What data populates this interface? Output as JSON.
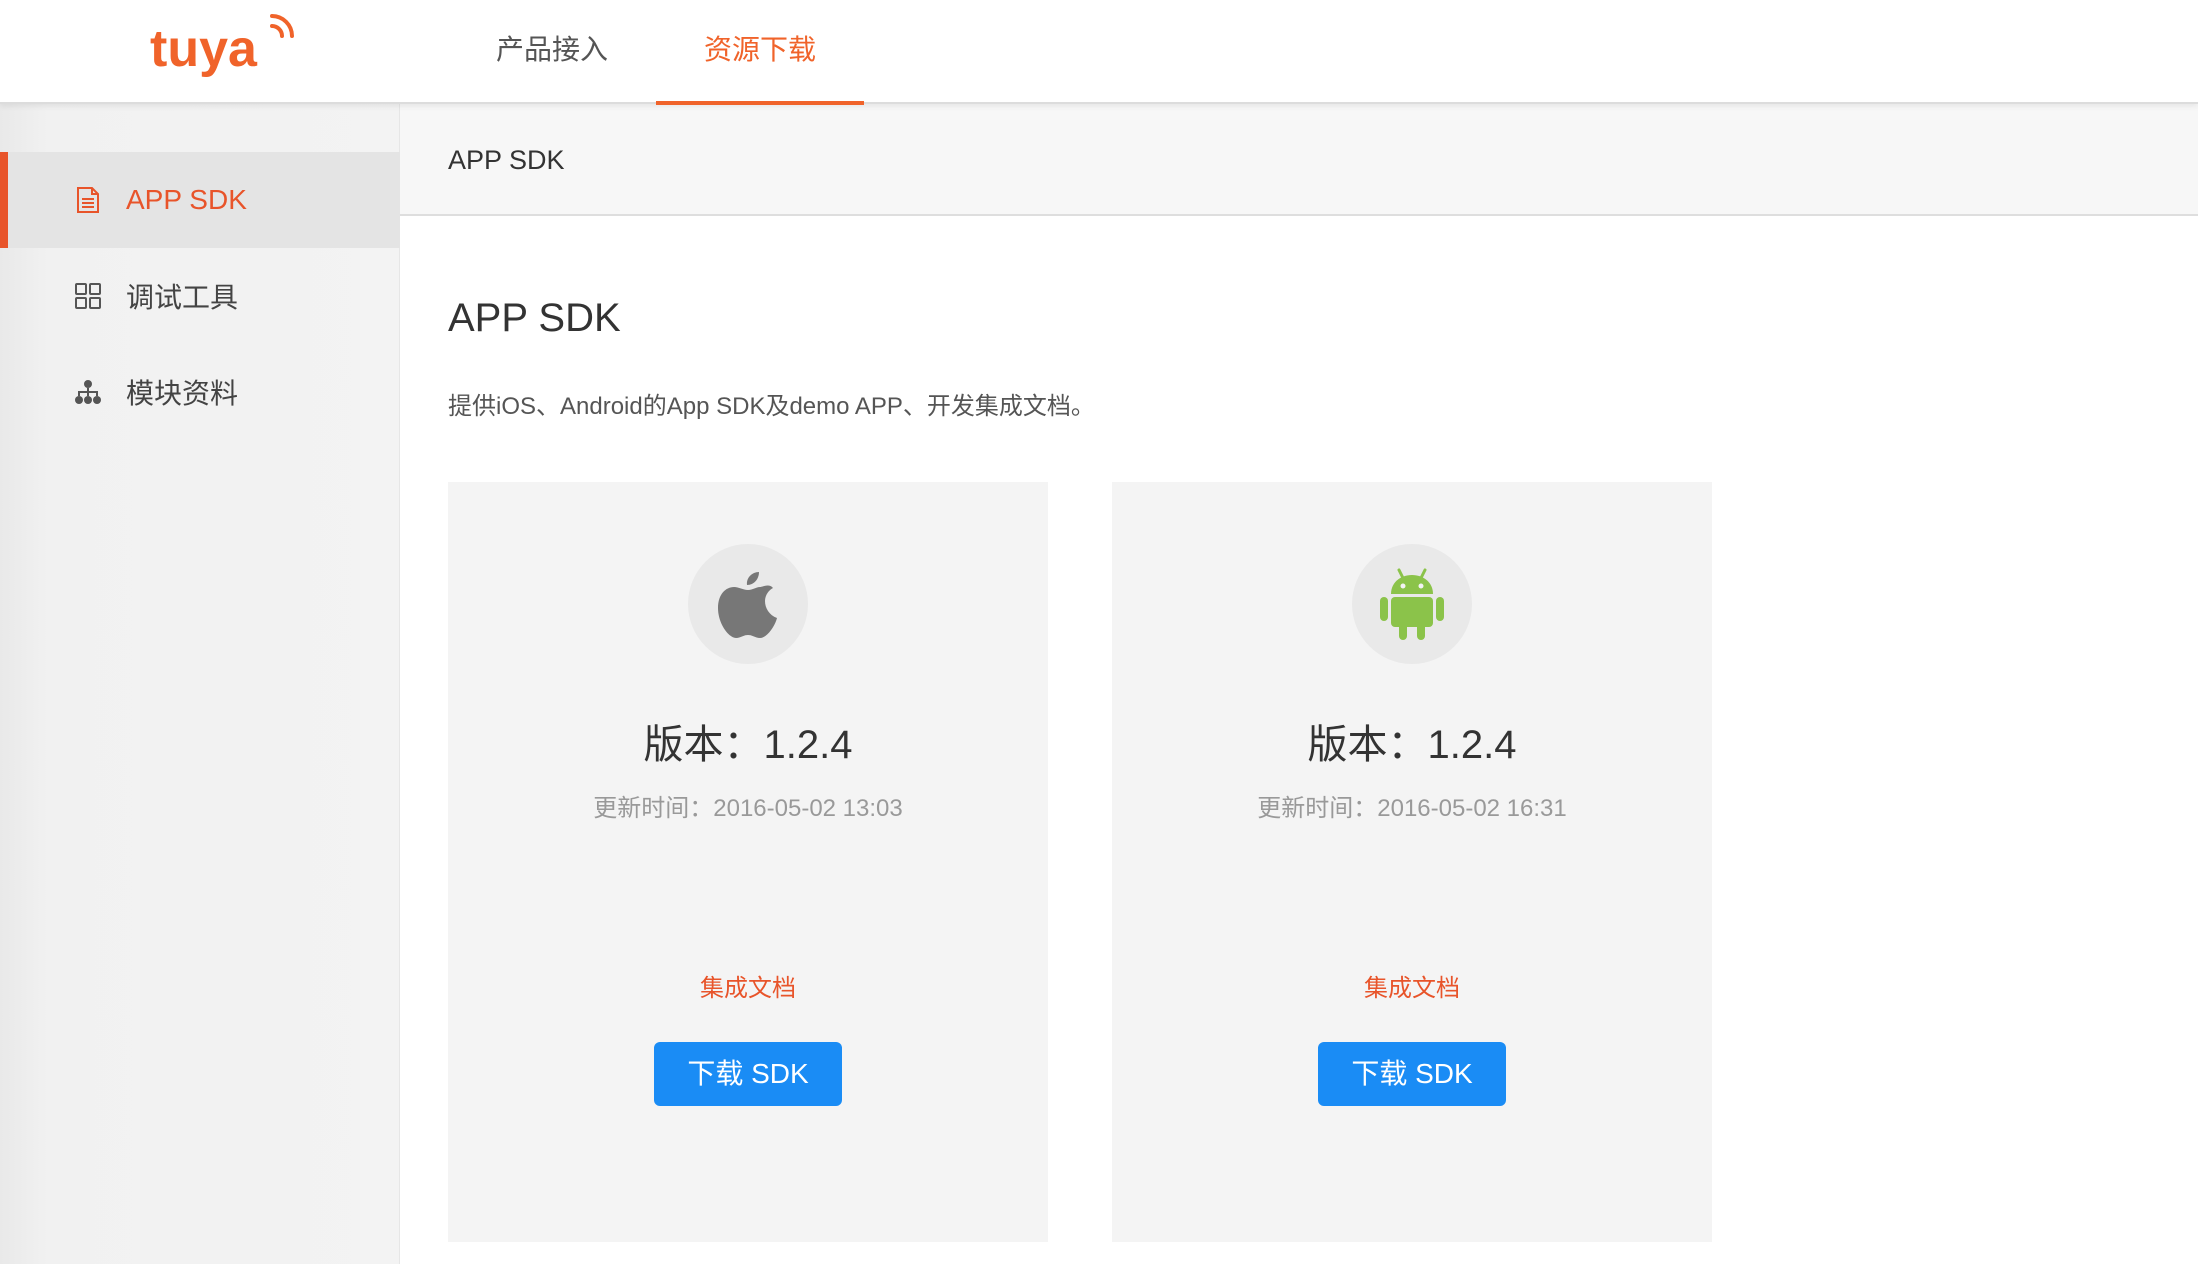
{
  "brand": {
    "logo_text": "tuya",
    "color": "#f0632a"
  },
  "nav": {
    "tabs": [
      {
        "label": "产品接入",
        "active": false
      },
      {
        "label": "资源下载",
        "active": true
      }
    ],
    "active_color": "#f0632a"
  },
  "sidebar": {
    "items": [
      {
        "label": "APP SDK",
        "icon": "document-icon",
        "active": true
      },
      {
        "label": "调试工具",
        "icon": "grid-icon",
        "active": false
      },
      {
        "label": "模块资料",
        "icon": "hierarchy-icon",
        "active": false
      }
    ],
    "active_color": "#e8542a"
  },
  "breadcrumb": {
    "current": "APP SDK"
  },
  "main": {
    "title": "APP SDK",
    "description": "提供iOS、Android的App SDK及demo APP、开发集成文档。",
    "cards": [
      {
        "platform_icon": "apple-icon",
        "version": "版本：1.2.4",
        "updated": "更新时间：2016-05-02 13:03",
        "doc_link": "集成文档",
        "download_label": "下载 SDK"
      },
      {
        "platform_icon": "android-icon",
        "version": "版本：1.2.4",
        "updated": "更新时间：2016-05-02 16:31",
        "doc_link": "集成文档",
        "download_label": "下载 SDK"
      }
    ],
    "button_color": "#1a8cf5",
    "android_color": "#8bc34a",
    "apple_color": "#777777"
  }
}
